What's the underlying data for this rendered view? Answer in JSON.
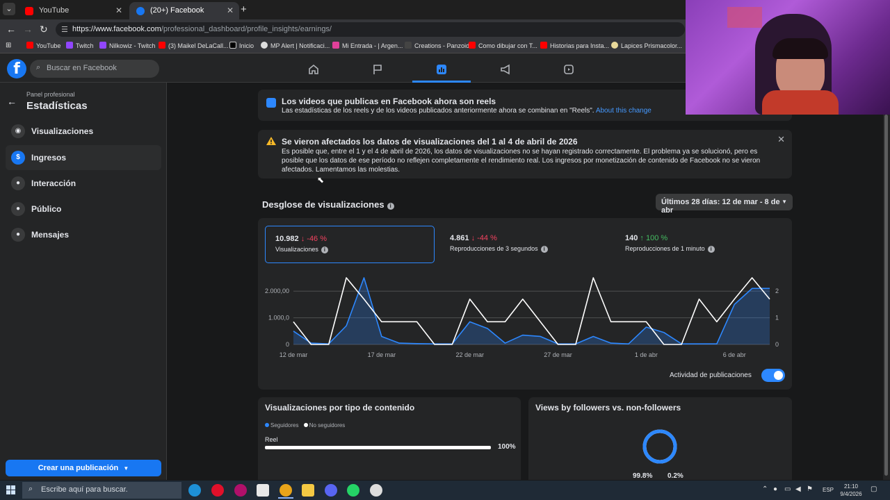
{
  "browser": {
    "tabs": [
      {
        "title": "YouTube",
        "active": false
      },
      {
        "title": "(20+) Facebook",
        "active": true
      }
    ],
    "url_host": "https://www.facebook.com",
    "url_path": "/professional_dashboard/profile_insights/earnings/",
    "bookmarks": [
      "YouTube",
      "Twitch",
      "Nilkowiz - Twitch",
      "(3) Maikel DeLaCall...",
      "Inicio",
      "MP Alert | Notificaci...",
      "Mi Entrada - | Argen...",
      "Creations - Panzoid",
      "Como dibujar con T...",
      "Historias para Insta...",
      "Lapices Prismacolor..."
    ]
  },
  "fb": {
    "logo": "f",
    "search_placeholder": "Buscar en Facebook",
    "nav_icons": [
      "home-icon",
      "flag-icon",
      "insights-icon",
      "megaphone-icon",
      "video-icon"
    ]
  },
  "sidebar": {
    "subtitle": "Panel profesional",
    "title": "Estadísticas",
    "items": [
      {
        "label": "Visualizaciones",
        "icon": "eye-icon",
        "glyph": "◉"
      },
      {
        "label": "Ingresos",
        "icon": "dollar-icon",
        "glyph": "$"
      },
      {
        "label": "Interacción",
        "icon": "chat-icon",
        "glyph": "●"
      },
      {
        "label": "Público",
        "icon": "people-icon",
        "glyph": "●"
      },
      {
        "label": "Mensajes",
        "icon": "messenger-icon",
        "glyph": "●"
      }
    ],
    "create_button": "Crear una publicación"
  },
  "banner": {
    "title": "Los videos que publicas en Facebook ahora son reels",
    "text": "Las estadísticas de los reels y de los videos publicados anteriormente ahora se combinan en \"Reels\".",
    "link": "About this change"
  },
  "warning": {
    "title": "Se vieron afectados los datos de visualizaciones del 1 al 4 de abril de 2026",
    "text": "Es posible que, entre el 1 y el 4 de abril de 2026, los datos de visualizaciones no se hayan registrado correctamente. El problema ya se solucionó, pero es posible que los datos de ese período no reflejen completamente el rendimiento real. Los ingresos por monetización de contenido de Facebook no se vieron afectados. Lamentamos las molestias."
  },
  "breakdown": {
    "title": "Desglose de visualizaciones",
    "range": "Últimos 28 días: 12 de mar - 8 de abr",
    "metrics": [
      {
        "value": "10.982",
        "change": "↓ -46 %",
        "dir": "down",
        "label": "Visualizaciones"
      },
      {
        "value": "4.861",
        "change": "↓ -44 %",
        "dir": "down",
        "label": "Reproducciones de 3 segundos"
      },
      {
        "value": "140",
        "change": "↑ 100 %",
        "dir": "up",
        "label": "Reproducciones de 1 minuto"
      }
    ],
    "activity_label": "Actividad de publicaciones",
    "activity_on": true
  },
  "chart_data": {
    "type": "line",
    "x": [
      "12 mar",
      "13 mar",
      "14 mar",
      "15 mar",
      "16 mar",
      "17 mar",
      "18 mar",
      "19 mar",
      "20 mar",
      "21 mar",
      "22 mar",
      "23 mar",
      "24 mar",
      "25 mar",
      "26 mar",
      "27 mar",
      "28 mar",
      "29 mar",
      "30 mar",
      "31 mar",
      "1 abr",
      "2 abr",
      "3 abr",
      "4 abr",
      "5 abr",
      "6 abr",
      "7 abr",
      "8 abr"
    ],
    "x_tick_labels": [
      "12 de mar",
      "17 de mar",
      "22 de mar",
      "27 de mar",
      "1 de abr",
      "6 de abr"
    ],
    "y_left_ticks": [
      "0",
      "1.000,0",
      "2.000,00"
    ],
    "y_right_ticks": [
      "0",
      "1",
      "2"
    ],
    "ylim_left": [
      0,
      2500
    ],
    "ylim_right": [
      0,
      2.5
    ],
    "series": [
      {
        "axis": "left",
        "color": "#2d88ff",
        "fill": true,
        "values": [
          500,
          50,
          20,
          700,
          2500,
          300,
          50,
          30,
          20,
          20,
          850,
          600,
          50,
          350,
          300,
          20,
          20,
          300,
          50,
          20,
          650,
          450,
          20,
          20,
          20,
          1500,
          2100,
          2100
        ]
      },
      {
        "axis": "right",
        "color": "#ffffff",
        "fill": false,
        "values": [
          0.85,
          0,
          0,
          2.5,
          1.7,
          0.85,
          0.85,
          0.85,
          0,
          0,
          1.7,
          0.85,
          0.85,
          1.7,
          0.85,
          0,
          0,
          2.5,
          0.85,
          0.85,
          0.85,
          0,
          0,
          1.7,
          0.85,
          1.7,
          2.5,
          1.7
        ]
      }
    ]
  },
  "content_type": {
    "title": "Visualizaciones por tipo de contenido",
    "legend": [
      "Seguidores",
      "No seguidores"
    ],
    "rows": [
      {
        "label": "Reel",
        "percent": 1.0,
        "pct_text": "100%"
      }
    ]
  },
  "followers": {
    "title": "Views by followers vs. non-followers",
    "followers_pct": "99.8%",
    "non_followers_pct": "0.2%",
    "followers_share": 0.998
  },
  "taskbar": {
    "search_placeholder": "Escribe aquí para buscar.",
    "lang": "ESP",
    "time": "21:10",
    "date": "9/4/2026"
  }
}
